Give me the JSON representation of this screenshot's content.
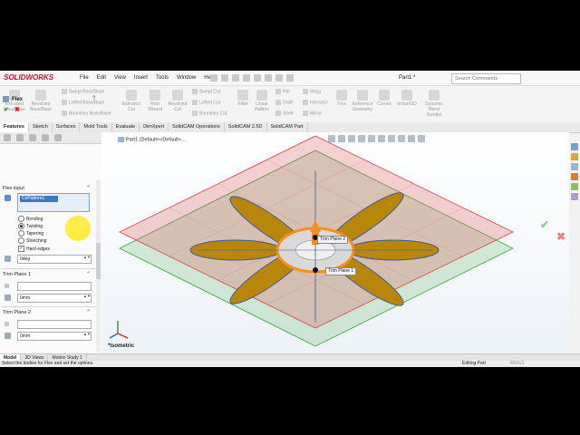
{
  "app": {
    "logo": "SOLIDWORKS",
    "doc_title": "Part1 *",
    "search_placeholder": "Search Commands"
  },
  "menus": [
    "File",
    "Edit",
    "View",
    "Insert",
    "Tools",
    "Window",
    "Help"
  ],
  "commands": {
    "sweep_boss": "Swept Boss/Base",
    "lofted_boss": "Lofted Boss/Base",
    "boundary_boss": "Boundary Boss/Base",
    "extruded_boss": "Extruded Boss/Base",
    "revolved_boss": "Revolved Boss/Base",
    "extruded_cut": "Extruded Cut",
    "hole_wizard": "Hole Wizard",
    "revolved_cut": "Revolved Cut",
    "swept_cut": "Swept Cut",
    "lofted_cut": "Lofted Cut",
    "boundary_cut": "Boundary Cut",
    "fillet": "Fillet",
    "linear_pattern": "Linear Pattern",
    "rib": "Rib",
    "draft": "Draft",
    "shell": "Shell",
    "wrap": "Wrap",
    "intersect": "Intersect",
    "mirror": "Mirror",
    "flex": "Flex",
    "reference_geometry": "Reference Geometry",
    "curves": "Curves",
    "instant3d": "Instant3D",
    "dynamic_mirror": "Dynamic Mirror Symbol"
  },
  "tabs": [
    "Features",
    "Sketch",
    "Surfaces",
    "Mold Tools",
    "Evaluate",
    "DimXpert",
    "SolidCAM Operations",
    "SolidCAM 2.5D",
    "SolidCAM Part"
  ],
  "active_tab": "Features",
  "breadcrumb": "Part1  (Default<<Default>...",
  "pm": {
    "title": "Flex",
    "flex_input_label": "Flex input",
    "body_selected": "CirPattern1",
    "options": [
      "Bending",
      "Twisting",
      "Tapering",
      "Stretching"
    ],
    "selected_option": "Twisting",
    "hard_edges_label": "Hard edges",
    "hard_edges_checked": true,
    "angle_value": "0deg",
    "trim1_label": "Trim Plane 1",
    "trim1_value": "0mm",
    "trim2_label": "Trim Plane 2",
    "trim2_value": "0mm"
  },
  "viewport": {
    "view_label": "*Isometric",
    "trim_plane_1": "Trim Plane 1",
    "trim_plane_2": "Trim Plane 2"
  },
  "bottom_tabs": [
    "Model",
    "3D Views",
    "Motion Study 1"
  ],
  "status": {
    "message": "Select the bodies for Flex and set the options.",
    "mode": "Editing Part",
    "units": "MMGS"
  },
  "colors": {
    "brand": "#c8102e",
    "plane_red": "#e05a5a",
    "plane_green": "#4caf50",
    "petal": "#b8860b",
    "manipulator": "#f5901e"
  }
}
